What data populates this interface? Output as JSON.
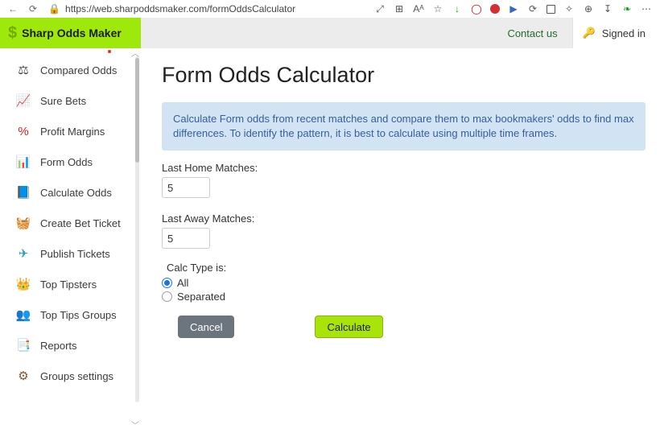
{
  "browser": {
    "url": "https://web.sharpoddsmaker.com/formOddsCalculator"
  },
  "app": {
    "brand": "Sharp Odds Maker",
    "contact": "Contact us",
    "signed_in": "Signed in"
  },
  "sidebar": {
    "items": [
      {
        "label": "Compared Odds",
        "icon": "compared-odds-icon"
      },
      {
        "label": "Sure Bets",
        "icon": "sure-bets-icon"
      },
      {
        "label": "Profit Margins",
        "icon": "profit-margins-icon"
      },
      {
        "label": "Form Odds",
        "icon": "form-odds-icon"
      },
      {
        "label": "Calculate Odds",
        "icon": "calculate-odds-icon"
      },
      {
        "label": "Create Bet Ticket",
        "icon": "create-bet-ticket-icon"
      },
      {
        "label": "Publish Tickets",
        "icon": "publish-tickets-icon"
      },
      {
        "label": "Top Tipsters",
        "icon": "top-tipsters-icon"
      },
      {
        "label": "Top Tips Groups",
        "icon": "top-tips-groups-icon"
      },
      {
        "label": "Reports",
        "icon": "reports-icon"
      },
      {
        "label": "Groups settings",
        "icon": "groups-settings-icon"
      }
    ]
  },
  "page": {
    "title": "Form Odds Calculator",
    "info": "Calculate Form odds from recent matches and compare them to max bookmakers' odds to find max differences. To identify the pattern, it is best to calculate using multiple time frames.",
    "last_home_label": "Last Home Matches:",
    "last_home_value": "5",
    "last_away_label": "Last Away Matches:",
    "last_away_value": "5",
    "calc_type_label": "Calc Type is:",
    "calc_type_options": {
      "all": "All",
      "separated": "Separated"
    },
    "calc_type_selected": "all",
    "cancel_label": "Cancel",
    "calculate_label": "Calculate"
  },
  "nav_icon_glyphs": {
    "compared-odds-icon": "⚖",
    "sure-bets-icon": "📈",
    "profit-margins-icon": "%",
    "form-odds-icon": "📊",
    "calculate-odds-icon": "📘",
    "create-bet-ticket-icon": "🧺",
    "publish-tickets-icon": "✈",
    "top-tipsters-icon": "👑",
    "top-tips-groups-icon": "👥",
    "reports-icon": "📑",
    "groups-settings-icon": "⚙"
  },
  "nav_icon_colors": {
    "compared-odds-icon": "#444",
    "sure-bets-icon": "#2e8b2e",
    "profit-margins-icon": "#d32020",
    "form-odds-icon": "#d37a20",
    "calculate-odds-icon": "#2a5da0",
    "create-bet-ticket-icon": "#6d3e20",
    "publish-tickets-icon": "#1aa0c0",
    "top-tipsters-icon": "#d4a820",
    "top-tips-groups-icon": "#b04020",
    "reports-icon": "#5fa820",
    "groups-settings-icon": "#7a5a30"
  }
}
